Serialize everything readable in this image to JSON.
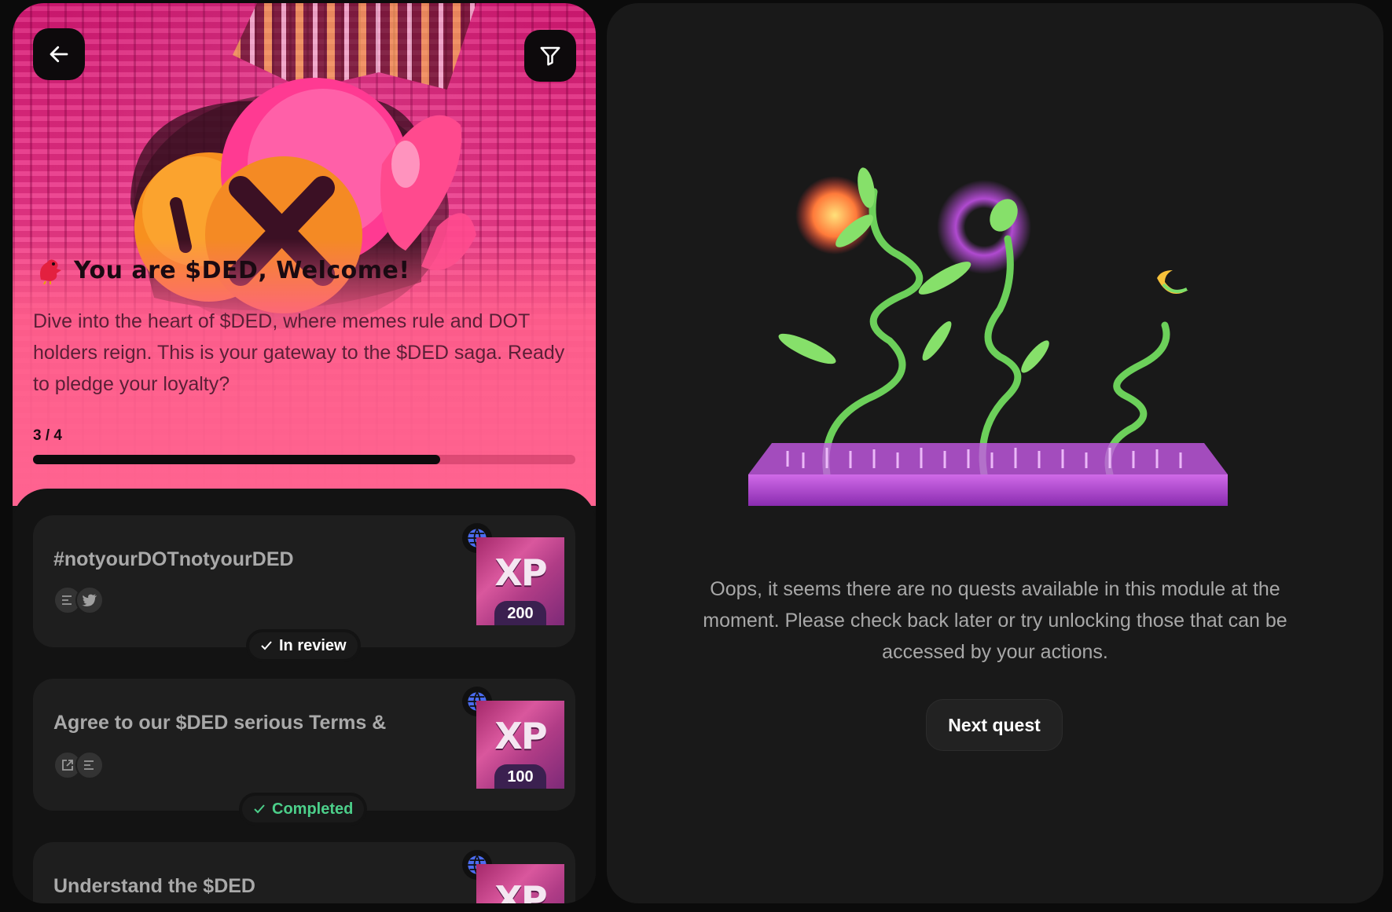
{
  "module": {
    "emoji_icon": "red-bird-icon",
    "title": "You are $DED, Welcome!",
    "description": "Dive into the heart of $DED, where memes rule and DOT holders reign. This is your gateway to the $DED saga. Ready to pledge your loyalty?",
    "progress_label": "3 / 4",
    "progress_current": 3,
    "progress_total": 4
  },
  "header": {
    "back_icon": "arrow-left-icon",
    "filter_icon": "filter-icon"
  },
  "quests": [
    {
      "title": "#notyourDOTnotyourDED",
      "tag_icons": [
        "text-lines-icon",
        "twitter-icon"
      ],
      "xp_label": "XP",
      "xp_amount": "200",
      "status": "In review",
      "status_color": "#ffffff"
    },
    {
      "title": "Agree to our $DED serious Terms &",
      "tag_icons": [
        "external-link-icon",
        "text-lines-icon"
      ],
      "xp_label": "XP",
      "xp_amount": "100",
      "status": "Completed",
      "status_color": "#4ccf8a"
    },
    {
      "title": "Understand the $DED",
      "xp_label": "XP"
    }
  ],
  "empty_state": {
    "message": "Oops, it seems there are no quests available in this module at the moment. Please check back later or try unlocking those that can be accessed by your actions.",
    "next_button": "Next quest"
  },
  "colors": {
    "hero_pink": "#ff5f8d",
    "panel_bg": "#191919",
    "card_bg": "#1e1e1e",
    "completed_green": "#4ccf8a",
    "globe_blue": "#4b6cf0"
  }
}
